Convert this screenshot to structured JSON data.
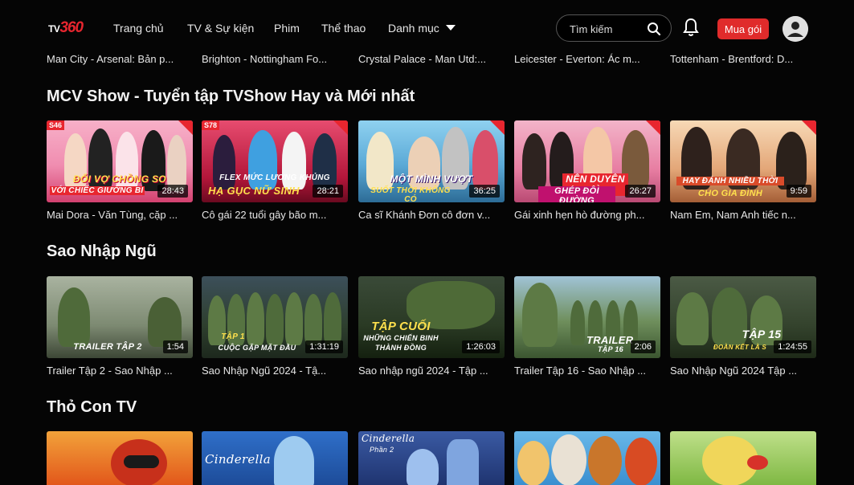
{
  "nav": {
    "logo_tv": "TV",
    "logo_num": "360",
    "items": [
      "Trang chủ",
      "TV & Sự kiện",
      "Phim",
      "Thể thao",
      "Danh mục"
    ],
    "search_placeholder": "Tìm kiếm",
    "buy_label": "Mua gói",
    "icons": [
      "search-icon",
      "bell-icon",
      "user-avatar-icon",
      "chevron-down-icon"
    ],
    "accent_color": "#e8262f"
  },
  "top_row": {
    "captions": [
      "Man City - Arsenal: Bản p...",
      "Brighton - Nottingham Fo...",
      "Crystal Palace - Man Utd:...",
      "Leicester - Everton: Ác m...",
      "Tottenham - Brentford: D..."
    ]
  },
  "sections": [
    {
      "title": "MCV Show - Tuyển tập TVShow Hay và Mới nhất",
      "items": [
        {
          "caption": "Mai Dora - Văn Tùng, cặp ...",
          "duration": "28:43",
          "badge": "S46",
          "overlay_lines": [
            "ĐỔI VỢ CHỒNG SO",
            "VỚI CHIẾC GIƯỜNG BI"
          ]
        },
        {
          "caption": "Cô gái 22 tuổi gây bão m...",
          "duration": "28:21",
          "badge": "S78",
          "overlay_lines": [
            "FLEX MỨC LƯƠNG KHỦNG",
            "HẠ GỤC NỮ SINH"
          ]
        },
        {
          "caption": "Ca sĩ Khánh Đơn cô đơn v...",
          "duration": "36:25",
          "badge": "",
          "overlay_lines": [
            "MỘT MÌNH VƯỢT",
            "SUỐT THỜI KHÔNG CÓ"
          ]
        },
        {
          "caption": "Gái xinh hẹn hò đường ph...",
          "duration": "26:27",
          "badge": "",
          "overlay_lines": [
            "NÊN DUYÊN TỪ",
            "GHÉP ĐÔI ĐƯỜNG"
          ]
        },
        {
          "caption": "Nam Em, Nam Anh tiếc n...",
          "duration": "9:59",
          "badge": "",
          "overlay_lines": [
            "HAY ĐÁNH NHIỀU THỜI",
            "CHO GIA ĐÌNH"
          ]
        }
      ]
    },
    {
      "title": "Sao Nhập Ngũ",
      "items": [
        {
          "caption": "Trailer Tập 2 - Sao Nhập ...",
          "duration": "1:54",
          "overlay_lines": [
            "TRAILER TẬP 2"
          ]
        },
        {
          "caption": "Sao Nhập Ngũ 2024 - Tậ...",
          "duration": "1:31:19",
          "overlay_lines": [
            "TẬP 1",
            "CUỘC GẶP MẶT ĐẦU"
          ]
        },
        {
          "caption": "Sao nhập ngũ 2024 - Tập ...",
          "duration": "1:26:03",
          "overlay_lines": [
            "TẬP CUỐI",
            "NHỮNG CHIẾN BINH",
            "THÀNH ĐỒNG"
          ]
        },
        {
          "caption": "Trailer Tập 16 - Sao Nhập ...",
          "duration": "2:06",
          "overlay_lines": [
            "TRAILER",
            "TẬP 16"
          ]
        },
        {
          "caption": "Sao Nhập Ngũ 2024 Tập ...",
          "duration": "1:24:55",
          "overlay_lines": [
            "TẬP 15",
            "ĐOÀN KẾT LÀ S"
          ]
        }
      ]
    },
    {
      "title": "Thỏ Con TV",
      "items": [
        {
          "overlay_lines": []
        },
        {
          "overlay_lines": [
            "Cinderella"
          ]
        },
        {
          "overlay_lines": [
            "Cinderella",
            "Phần 2"
          ]
        },
        {
          "overlay_lines": []
        },
        {
          "overlay_lines": []
        }
      ]
    }
  ]
}
